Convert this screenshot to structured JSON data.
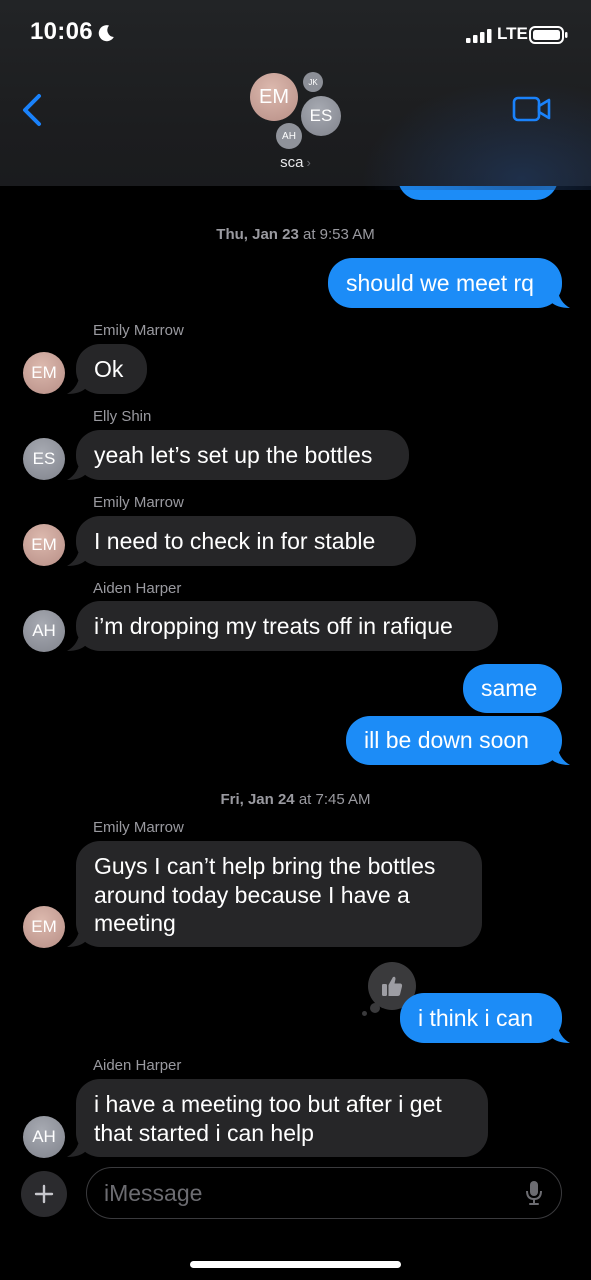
{
  "status_bar": {
    "time": "10:06",
    "network": "LTE",
    "moon_icon": "moon-icon",
    "signal_icon": "cellular-signal-icon",
    "battery_icon": "battery-icon"
  },
  "header": {
    "back_icon": "chevron-left-icon",
    "video_icon": "video-camera-icon",
    "group_name": "sca",
    "group_avatars": [
      "EM",
      "JK",
      "ES",
      "AH"
    ]
  },
  "conversation": {
    "timestamps": [
      {
        "day": "Thu, Jan 23",
        "at": "at",
        "time": "9:53 AM"
      },
      {
        "day": "Fri, Jan 24",
        "at": "at",
        "time": "7:45 AM"
      }
    ],
    "messages": [
      {
        "from": "me",
        "text": "should we meet rq"
      },
      {
        "from": "Emily Marrow",
        "initials": "EM",
        "text": "Ok"
      },
      {
        "from": "Elly Shin",
        "initials": "ES",
        "text": "yeah let’s set up the bottles"
      },
      {
        "from": "Emily Marrow",
        "initials": "EM",
        "text": "I need to check in for stable"
      },
      {
        "from": "Aiden Harper",
        "initials": "AH",
        "text": "i’m dropping my treats off in rafique"
      },
      {
        "from": "me",
        "text": "same"
      },
      {
        "from": "me",
        "text": "ill be down soon"
      },
      {
        "from": "Emily Marrow",
        "initials": "EM",
        "lines": [
          "Guys I can’t help bring the bottles",
          "around today because I have a",
          "meeting"
        ]
      },
      {
        "from": "me",
        "text": "i think i can",
        "tapback": "thumbs-up-icon"
      },
      {
        "from": "Aiden Harper",
        "initials": "AH",
        "lines": [
          "i have a meeting too but after i get",
          "that started i can help"
        ]
      }
    ]
  },
  "composer": {
    "placeholder": "iMessage",
    "plus_icon": "plus-icon",
    "mic_icon": "microphone-icon"
  },
  "colors": {
    "outgoing_bubble": "#1c8cf7",
    "incoming_bubble": "#262628",
    "accent": "#1a82fb",
    "background": "#000000"
  }
}
